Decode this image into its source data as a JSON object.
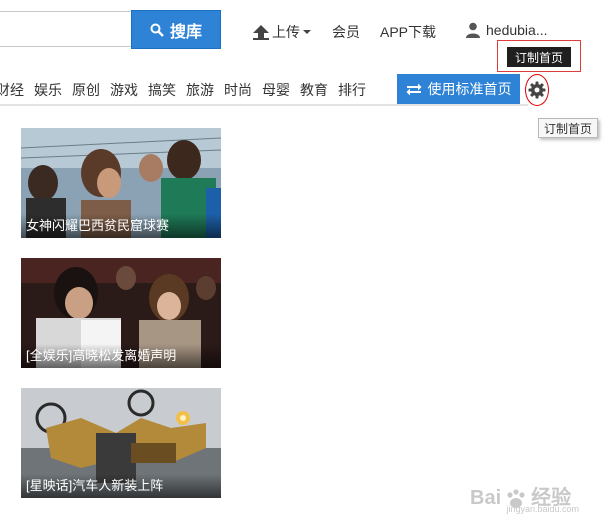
{
  "search": {
    "button_label": "搜库"
  },
  "header": {
    "upload_label": "上传",
    "member_label": "会员",
    "app_label": "APP下载",
    "username": "hedubia..."
  },
  "nav": {
    "items": [
      "财经",
      "娱乐",
      "原创",
      "游戏",
      "搞笑",
      "旅游",
      "时尚",
      "母婴",
      "教育",
      "排行"
    ]
  },
  "toolbar": {
    "standard_label": "使用标准首页",
    "tooltip_top": "订制首页",
    "tooltip_side": "订制首页"
  },
  "cards": [
    {
      "caption": "女神闪耀巴西贫民窟球赛"
    },
    {
      "caption": "[全娱乐]高晓松发离婚声明"
    },
    {
      "caption": "[星映话]汽车人新装上阵"
    }
  ],
  "watermark": {
    "text": "Bai",
    "text2": "经验",
    "sub": "jingyan.baidu.com"
  },
  "colors": {
    "accent": "#2f83d6",
    "highlight": "#e03c3c"
  }
}
